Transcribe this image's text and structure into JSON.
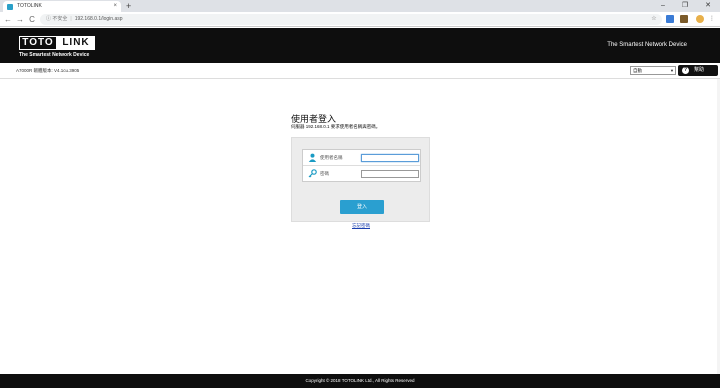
{
  "browser": {
    "tab_title": "TOTOLINK",
    "tab_close": "×",
    "new_tab": "+",
    "minimize": "–",
    "maximize": "❐",
    "close": "✕",
    "back": "←",
    "forward": "→",
    "reload": "C",
    "security_label": "ⓘ 不安全",
    "url": "192.168.0.1/login.asp",
    "star": "☆"
  },
  "header": {
    "logo_left": "TOTO",
    "logo_right": "LINK",
    "logo_subtitle": "The Smartest Network Device",
    "tagline": "The Smartest Network Device"
  },
  "infobar": {
    "firmware_info": "A7000R 韌體版本: V4.1cu.3905",
    "language_selected": "自動",
    "help_label": "幫助"
  },
  "login": {
    "title": "使用者登入",
    "description": "伺服器 192.168.0.1 要求使用者名稱與密碼。",
    "username_label": "使用者名稱",
    "password_label": "密碼",
    "username_value": "",
    "password_value": "",
    "login_button": "登入",
    "forgot_password": "忘記密碼"
  },
  "footer": {
    "copyright": "Copyright © 2018 TOTOLINK Ltd., All Rights Reserved"
  },
  "colors": {
    "header_bg": "#0e0e0e",
    "accent": "#2a9fd0",
    "panel_bg": "#ececec"
  },
  "icons": {
    "user": "user-icon",
    "key": "key-icon",
    "help": "help-icon"
  }
}
